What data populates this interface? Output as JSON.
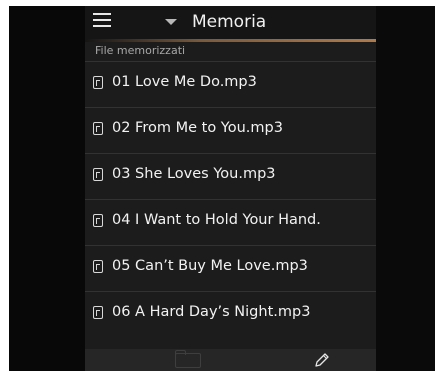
{
  "header": {
    "title": "Memoria"
  },
  "section_label": "File memorizzati",
  "files": [
    "01 Love Me Do.mp3",
    "02 From Me to You.mp3",
    "03 She Loves You.mp3",
    "04 I Want to Hold Your Hand.",
    "05 Can’t Buy Me Love.mp3",
    "06 A Hard Day’s Night.mp3"
  ],
  "icons": {
    "menu": "hamburger-menu-icon",
    "dropdown": "chevron-down-icon",
    "file": "music-file-icon",
    "folder": "folder-icon",
    "edit": "pencil-icon"
  },
  "colors": {
    "accent": "#b07a4a",
    "panel": "#1c1c1c",
    "text": "#f2f2f2"
  }
}
